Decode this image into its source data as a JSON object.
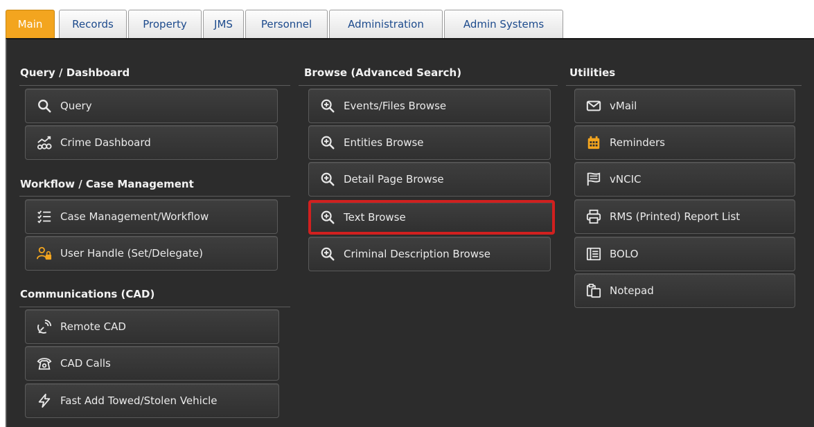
{
  "tabs": [
    {
      "label": "Main",
      "active": true
    },
    {
      "label": "Records",
      "active": false
    },
    {
      "label": "Property",
      "active": false
    },
    {
      "label": "JMS",
      "active": false
    },
    {
      "label": "Personnel",
      "active": false
    },
    {
      "label": "Administration",
      "active": false
    },
    {
      "label": "Admin Systems",
      "active": false
    }
  ],
  "query_dashboard": {
    "title": "Query / Dashboard",
    "items": [
      {
        "label": "Query",
        "icon": "magnifier-icon"
      },
      {
        "label": "Crime Dashboard",
        "icon": "dashboard-chart-icon"
      }
    ]
  },
  "workflow": {
    "title": "Workflow / Case Management",
    "items": [
      {
        "label": "Case Management/Workflow",
        "icon": "checklist-icon"
      },
      {
        "label": "User Handle (Set/Delegate)",
        "icon": "user-lock-icon"
      }
    ]
  },
  "communications": {
    "title": "Communications (CAD)",
    "items": [
      {
        "label": "Remote CAD",
        "icon": "satellite-dish-icon"
      },
      {
        "label": "CAD Calls",
        "icon": "telephone-icon"
      },
      {
        "label": "Fast Add Towed/Stolen Vehicle",
        "icon": "lightning-icon"
      }
    ]
  },
  "browse": {
    "title": "Browse (Advanced Search)",
    "items": [
      {
        "label": "Events/Files Browse",
        "icon": "zoom-in-icon"
      },
      {
        "label": "Entities Browse",
        "icon": "zoom-in-icon"
      },
      {
        "label": "Detail Page Browse",
        "icon": "zoom-in-icon"
      },
      {
        "label": "Text Browse",
        "icon": "zoom-in-icon",
        "highlighted": true
      },
      {
        "label": "Criminal Description Browse",
        "icon": "zoom-in-icon"
      }
    ]
  },
  "utilities": {
    "title": "Utilities",
    "items": [
      {
        "label": "vMail",
        "icon": "envelope-icon"
      },
      {
        "label": "Reminders",
        "icon": "calendar-icon"
      },
      {
        "label": "vNCIC",
        "icon": "flag-icon"
      },
      {
        "label": "RMS (Printed) Report List",
        "icon": "printer-icon"
      },
      {
        "label": "BOLO",
        "icon": "bulletin-icon"
      },
      {
        "label": "Notepad",
        "icon": "clipboard-icon"
      }
    ]
  },
  "colors": {
    "active_tab": "#f3a51f",
    "panel_bg": "#2c2c2c",
    "highlight_border": "#d1201f"
  }
}
